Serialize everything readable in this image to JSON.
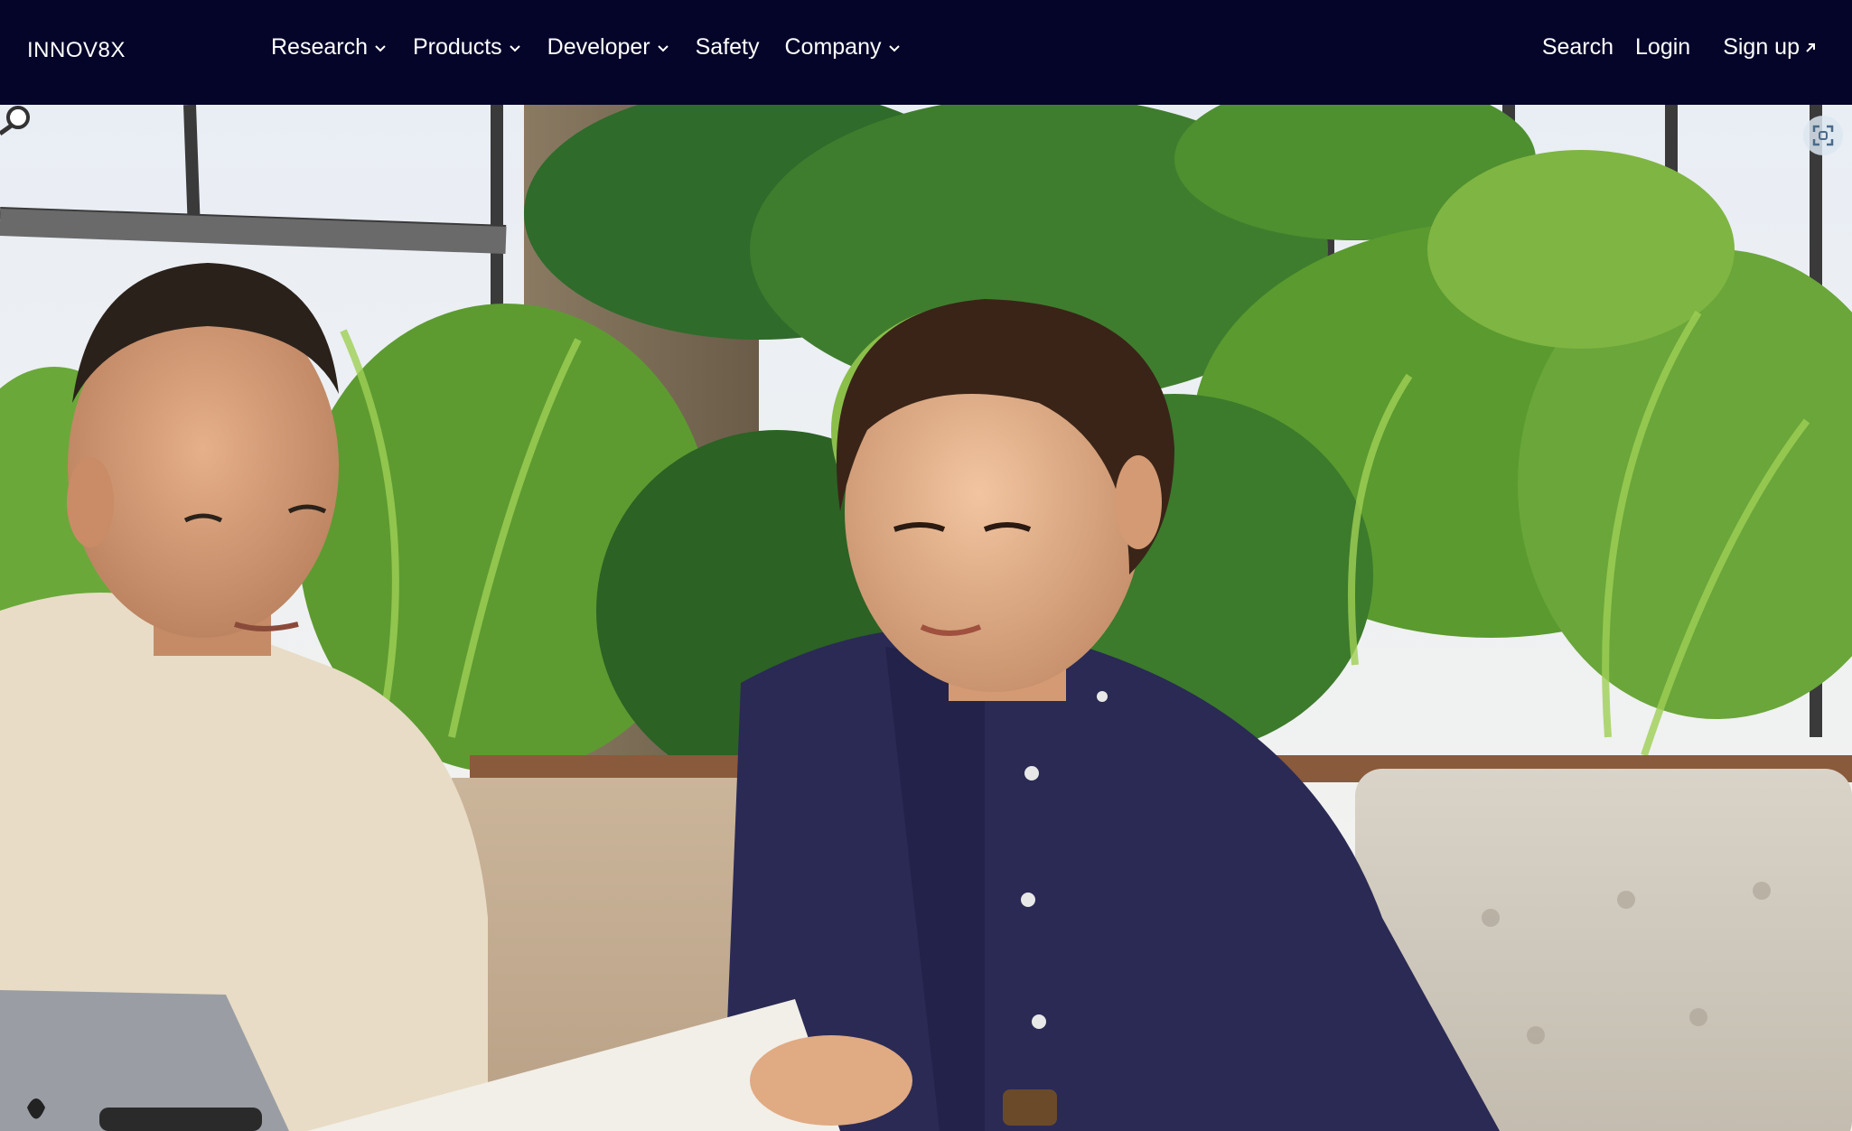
{
  "brand": {
    "logo_text": "INNOV8X"
  },
  "nav": {
    "items": [
      {
        "label": "Research",
        "has_dropdown": true
      },
      {
        "label": "Products",
        "has_dropdown": true
      },
      {
        "label": "Developer",
        "has_dropdown": true
      },
      {
        "label": "Safety",
        "has_dropdown": false
      },
      {
        "label": "Company",
        "has_dropdown": true
      }
    ],
    "search_label": "Search",
    "login_label": "Login",
    "signup_label": "Sign up"
  },
  "hero": {
    "icons": [
      "expand-icon"
    ]
  },
  "colors": {
    "nav_bg": "#05052a",
    "nav_text": "#ffffff"
  }
}
